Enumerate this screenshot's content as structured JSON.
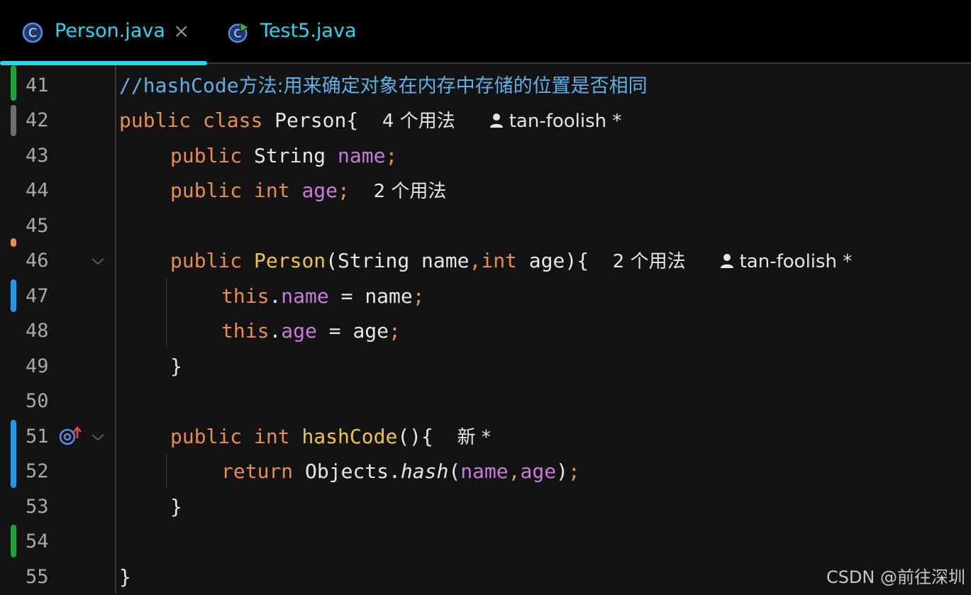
{
  "tabs": [
    {
      "label": "Person.java",
      "active": true
    },
    {
      "label": "Test5.java",
      "active": false
    }
  ],
  "tab_close_label": "×",
  "line_numbers": [
    "41",
    "42",
    "43",
    "44",
    "45",
    "46",
    "47",
    "48",
    "49",
    "50",
    "51",
    "52",
    "53",
    "54",
    "55"
  ],
  "code": {
    "l41": {
      "comment_prefix": "//hashCode",
      "comment_rest": "方法:用来确定对象在内存中存储的位置是否相同"
    },
    "l42": {
      "kw1": "public",
      "kw2": "class",
      "name": "Person{",
      "hint_usages": "4 个用法",
      "author": "tan-foolish *"
    },
    "l43": {
      "kw": "public",
      "type": "String",
      "field": "name",
      "semi": ";"
    },
    "l44": {
      "kw1": "public",
      "kw2": "int",
      "field": "age",
      "semi": ";",
      "hint_usages": "2 个用法"
    },
    "l46": {
      "kw": "public",
      "fn": "Person",
      "open": "(",
      "type1": "String",
      "p1": "name",
      "comma": ",",
      "kw2": "int",
      "p2": "age",
      "close": "){",
      "hint_usages": "2 个用法",
      "author": "tan-foolish *"
    },
    "l47": {
      "this": "this",
      "dot": ".",
      "field": "name",
      "eq": " = ",
      "val": "name",
      "semi": ";"
    },
    "l48": {
      "this": "this",
      "dot": ".",
      "field": "age",
      "eq": " = ",
      "val": "age",
      "semi": ";"
    },
    "l49": {
      "brace": "}"
    },
    "l51": {
      "kw1": "public",
      "kw2": "int",
      "fn": "hashCode",
      "rest": "(){",
      "hint_new": "新 *"
    },
    "l52": {
      "kw": "return",
      "obj": "Objects",
      "dot": ".",
      "fn": "hash",
      "open": "(",
      "a1": "name",
      "comma": ",",
      "a2": "age",
      "close": ")",
      "semi": ";"
    },
    "l53": {
      "brace": "}"
    },
    "l55": {
      "brace": "}"
    }
  },
  "watermark": "CSDN @前往深圳",
  "colors": {
    "tab_active": "#27d8f2",
    "keyword": "#e98d50",
    "field": "#c77dda",
    "function": "#f0c44c",
    "comment": "#5fafe6",
    "change_added": "#1aa63a",
    "change_modified": "#1e9bf0"
  }
}
